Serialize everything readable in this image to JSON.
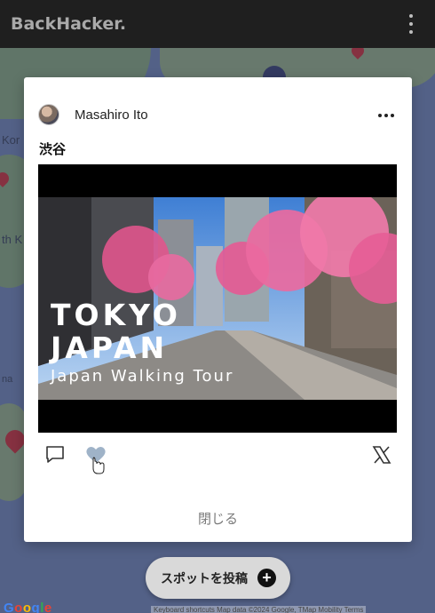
{
  "app": {
    "brand": "BackHacker."
  },
  "map": {
    "labels": [
      "Kor",
      "th K",
      "na"
    ],
    "google_logo": "Google",
    "attribution": "Keyboard shortcuts  Map data ©2024 Google, TMap Mobility  Terms"
  },
  "post": {
    "author": "Masahiro Ito",
    "title": "渋谷",
    "video": {
      "line1": "TOKYO",
      "line2": "JAPAN",
      "line3": "Japan Walking Tour"
    },
    "close_label": "閉じる"
  },
  "fab": {
    "label": "スポットを投稿",
    "plus": "+"
  },
  "icons": {
    "comment": "comment-icon",
    "like": "heart-icon",
    "share": "x-logo-icon",
    "more": "more-horizontal-icon",
    "menu": "more-vertical-icon",
    "cursor": "hand-pointer-icon"
  },
  "colors": {
    "heart": "#9fb3c8",
    "appbar": "#1f1f1f",
    "fab": "#d9d9d9"
  }
}
